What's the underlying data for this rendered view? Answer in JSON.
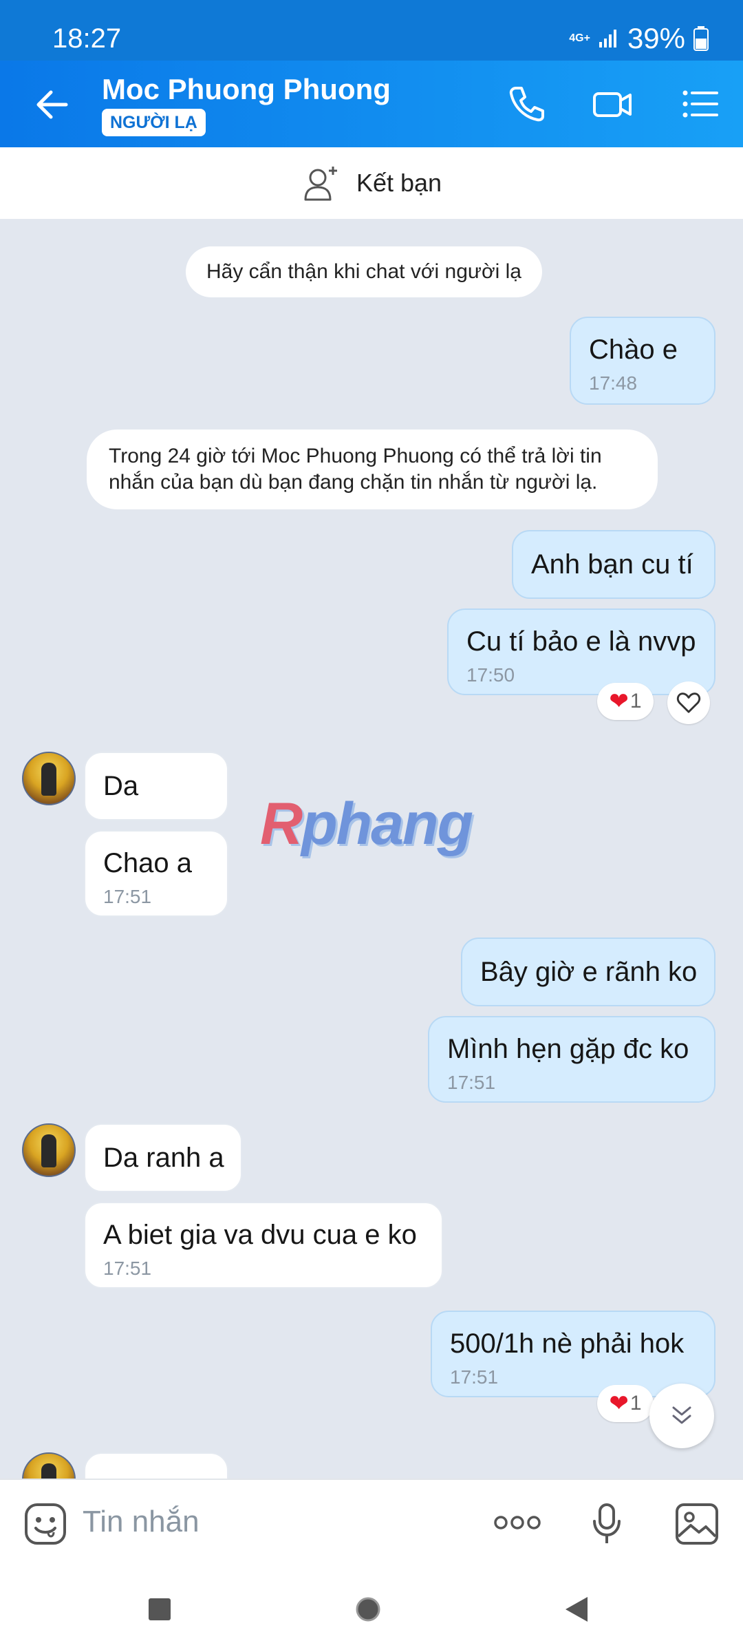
{
  "status_bar": {
    "time": "18:27",
    "network": "4G+",
    "battery": "39%"
  },
  "header": {
    "contact_name": "Moc Phuong Phuong",
    "badge": "NGƯỜI LẠ"
  },
  "add_friend": {
    "label": "Kết bạn"
  },
  "system_messages": {
    "caution": "Hãy cẩn thận khi chat với người lạ",
    "notice_line1": "Trong 24 giờ tới Moc Phuong Phuong có thể trả lời tin",
    "notice_line2": "nhắn của bạn dù bạn đang chặn tin nhắn từ người lạ."
  },
  "messages": [
    {
      "dir": "out",
      "text": "Chào e",
      "time": "17:48"
    },
    {
      "dir": "out",
      "text": "Anh bạn cu tí",
      "time": ""
    },
    {
      "dir": "out",
      "text": "Cu tí bảo e là nvvp",
      "time": "17:50",
      "reaction_count": "1"
    },
    {
      "dir": "in",
      "text": "Da",
      "time": ""
    },
    {
      "dir": "in",
      "text": "Chao a",
      "time": "17:51"
    },
    {
      "dir": "out",
      "text": "Bây giờ e rãnh ko",
      "time": ""
    },
    {
      "dir": "out",
      "text": "Mình hẹn gặp đc ko",
      "time": "17:51"
    },
    {
      "dir": "in",
      "text": "Da ranh a",
      "time": ""
    },
    {
      "dir": "in",
      "text": "A biet gia va dvu cua e ko",
      "time": "17:51"
    },
    {
      "dir": "out",
      "text": "500/1h nè phải hok",
      "time": "17:51",
      "reaction_count": "1"
    }
  ],
  "watermark": {
    "first": "R",
    "rest": "phang"
  },
  "composer": {
    "placeholder": "Tin nhắn"
  },
  "colors": {
    "header": "#0a78e8",
    "outgoing_bubble": "#d5ecfe",
    "incoming_bubble": "#ffffff",
    "chat_bg": "#e2e7ef"
  }
}
